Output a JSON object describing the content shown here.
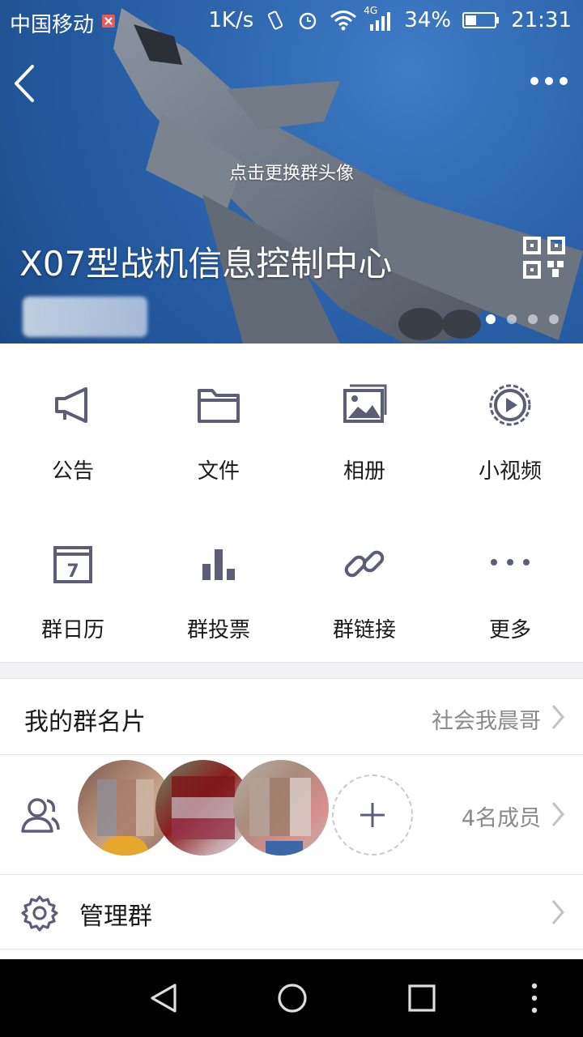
{
  "status_bar": {
    "carrier": "中国移动",
    "speed": "1K/s",
    "network": "4G",
    "battery": "34%",
    "time": "21:31"
  },
  "header": {
    "change_avatar_hint": "点击更换群头像",
    "group_name": "X07型战机信息控制中心",
    "carousel_pages": 4,
    "carousel_active": 1
  },
  "features": [
    {
      "label": "公告",
      "icon": "megaphone-icon"
    },
    {
      "label": "文件",
      "icon": "folder-icon"
    },
    {
      "label": "相册",
      "icon": "album-icon"
    },
    {
      "label": "小视频",
      "icon": "video-icon"
    },
    {
      "label": "群日历",
      "icon": "calendar-icon",
      "calendar_day": "7"
    },
    {
      "label": "群投票",
      "icon": "vote-chart-icon"
    },
    {
      "label": "群链接",
      "icon": "link-icon"
    },
    {
      "label": "更多",
      "icon": "more-icon"
    }
  ],
  "group_card": {
    "title": "我的群名片",
    "value": "社会我晨哥"
  },
  "members": {
    "count_label": "4名成员"
  },
  "manage": {
    "title": "管理群"
  },
  "colors": {
    "icon": "#5b5e75",
    "text": "#1a1a1a",
    "secondary": "#8a8a8e"
  }
}
